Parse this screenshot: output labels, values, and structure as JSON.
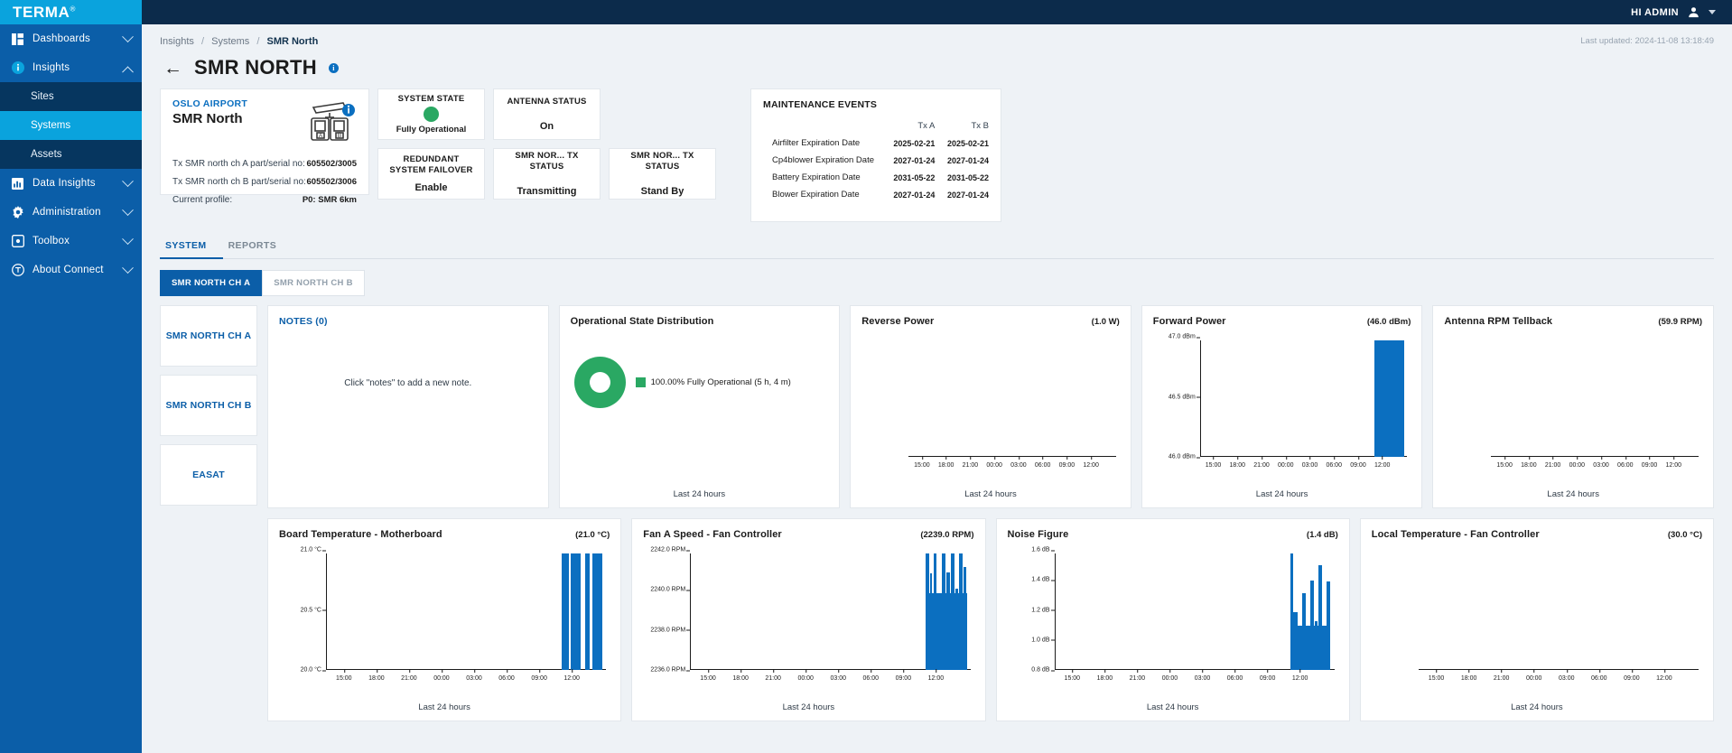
{
  "topbar": {
    "brand": "TERMA",
    "brand_sup": "®",
    "user_label": "HI ADMIN",
    "avatar_icon": "user-avatar-icon",
    "caret_icon": "chevron-down-icon"
  },
  "sidebar": {
    "items": [
      {
        "label": "Dashboards",
        "icon": "dashboard-grid-icon",
        "chevron": "chevron-down-icon",
        "expanded": false
      },
      {
        "label": "Insights",
        "icon": "info-circle-icon",
        "chevron": "chevron-up-icon",
        "expanded": true
      },
      {
        "label": "Data Insights",
        "icon": "bar-chart-icon",
        "chevron": "chevron-down-icon",
        "expanded": false
      },
      {
        "label": "Administration",
        "icon": "gear-icon",
        "chevron": "chevron-down-icon",
        "expanded": false
      },
      {
        "label": "Toolbox",
        "icon": "toolbox-icon",
        "chevron": "chevron-down-icon",
        "expanded": false
      },
      {
        "label": "About Connect",
        "icon": "t-circle-icon",
        "chevron": "chevron-down-icon",
        "expanded": false
      }
    ],
    "insights_children": [
      {
        "label": "Sites",
        "active": false
      },
      {
        "label": "Systems",
        "active": true
      },
      {
        "label": "Assets",
        "active": false
      }
    ]
  },
  "header": {
    "breadcrumb": {
      "root": "Insights",
      "middle": "Systems",
      "current": "SMR North",
      "separator": "/"
    },
    "last_updated": "Last updated: 2024-11-08 13:18:49",
    "back_icon": "back-arrow-icon",
    "title": "SMR NORTH",
    "info_icon": "info-icon",
    "info_glyph": "i"
  },
  "id_card": {
    "site": "OSLO AIRPORT",
    "system": "SMR North",
    "radar_icon": "radar-antenna-icon",
    "badge_icon": "info-icon",
    "rows": [
      {
        "label": "Tx SMR north ch A part/serial no:",
        "value": "605502/3005"
      },
      {
        "label": "Tx SMR north ch B part/serial no:",
        "value": "605502/3006"
      },
      {
        "label": "Current profile:",
        "value": "P0: SMR 6km"
      }
    ]
  },
  "tiles": [
    {
      "title": "SYSTEM STATE",
      "value": "Fully Operational",
      "indicator": "status-dot",
      "color": "#2aa863"
    },
    {
      "title": "ANTENNA STATUS",
      "value": "On",
      "indicator": "none"
    },
    {
      "title": "REDUNDANT SYSTEM FAILOVER",
      "value": "Enable",
      "indicator": "none"
    },
    {
      "title": "SMR NOR... TX STATUS",
      "value": "Transmitting",
      "indicator": "none"
    },
    {
      "title": "SMR NOR... TX STATUS",
      "value": "Stand By",
      "indicator": "none"
    }
  ],
  "maintenance": {
    "title": "MAINTENANCE EVENTS",
    "columns": [
      "",
      "Tx A",
      "Tx B"
    ],
    "rows": [
      {
        "name": "Airfilter Expiration Date",
        "tx_a": "2025-02-21",
        "tx_b": "2025-02-21"
      },
      {
        "name": "Cp4blower Expiration Date",
        "tx_a": "2027-01-24",
        "tx_b": "2027-01-24"
      },
      {
        "name": "Battery Expiration Date",
        "tx_a": "2031-05-22",
        "tx_b": "2031-05-22"
      },
      {
        "name": "Blower Expiration Date",
        "tx_a": "2027-01-24",
        "tx_b": "2027-01-24"
      }
    ]
  },
  "tabs": [
    {
      "label": "SYSTEM",
      "active": true
    },
    {
      "label": "REPORTS",
      "active": false
    }
  ],
  "channel_tabs": [
    {
      "label": "SMR NORTH CH A",
      "active": true
    },
    {
      "label": "SMR NORTH CH B",
      "active": false
    }
  ],
  "side_cards": [
    {
      "label": "SMR NORTH CH A"
    },
    {
      "label": "SMR NORTH CH B"
    },
    {
      "label": "EASAT"
    }
  ],
  "notes": {
    "title": "NOTES (0)",
    "hint": "Click \"notes\" to add a new note."
  },
  "chart_data": [
    {
      "type": "pie",
      "title": "Operational State Distribution",
      "footer": "Last 24 hours",
      "slices": [
        {
          "label": "100.00% Fully Operational (5 h, 4 m)",
          "value": 100,
          "color": "#2aa863"
        }
      ],
      "legend": "right"
    },
    {
      "type": "bar",
      "title": "Reverse Power",
      "current_value": "(1.0 W)",
      "footer": "Last 24 hours",
      "xlabel": "Last 24 hours",
      "ylabel": "",
      "yticks": [],
      "xticks": [
        "15:00",
        "18:00",
        "21:00",
        "00:00",
        "03:00",
        "06:00",
        "09:00",
        "12:00"
      ],
      "values": [],
      "grid": false
    },
    {
      "type": "bar",
      "title": "Forward Power",
      "current_value": "(46.0 dBm)",
      "footer": "Last 24 hours",
      "xlabel": "Last 24 hours",
      "yticks": [
        "47.0 dBm",
        "46.5 dBm",
        "46.0 dBm"
      ],
      "ylim": [
        46.0,
        47.0
      ],
      "xticks": [
        "15:00",
        "18:00",
        "21:00",
        "00:00",
        "03:00",
        "06:00",
        "09:00",
        "12:00"
      ],
      "bars": [
        {
          "x_pct": 84.0,
          "w_pct": 14.5,
          "h_pct": 100
        }
      ],
      "grid": false
    },
    {
      "type": "bar",
      "title": "Antenna RPM Tellback",
      "current_value": "(59.9 RPM)",
      "footer": "Last 24 hours",
      "xlabel": "Last 24 hours",
      "yticks": [],
      "xticks": [
        "15:00",
        "18:00",
        "21:00",
        "00:00",
        "03:00",
        "06:00",
        "09:00",
        "12:00"
      ],
      "values": [],
      "grid": false
    },
    {
      "type": "bar",
      "title": "Board Temperature - Motherboard",
      "current_value": "(21.0 °C)",
      "footer": "Last 24 hours",
      "xlabel": "Last 24 hours",
      "yticks": [
        "21.0 °C",
        "20.5 °C",
        "20.0 °C"
      ],
      "ylim": [
        20.0,
        21.0
      ],
      "xticks": [
        "15:00",
        "18:00",
        "21:00",
        "00:00",
        "03:00",
        "06:00",
        "09:00",
        "12:00"
      ],
      "bars": [
        {
          "x_pct": 84.0,
          "w_pct": 2.6,
          "h_pct": 100
        },
        {
          "x_pct": 87.4,
          "w_pct": 3.6,
          "h_pct": 100
        },
        {
          "x_pct": 92.4,
          "w_pct": 1.6,
          "h_pct": 100
        },
        {
          "x_pct": 95.0,
          "w_pct": 3.6,
          "h_pct": 100
        }
      ],
      "grid": false
    },
    {
      "type": "bar",
      "title": "Fan A Speed - Fan Controller",
      "current_value": "(2239.0 RPM)",
      "footer": "Last 24 hours",
      "xlabel": "Last 24 hours",
      "yticks": [
        "2242.0 RPM",
        "2240.0 RPM",
        "2238.0 RPM",
        "2236.0 RPM"
      ],
      "ylim": [
        2236.0,
        2242.0
      ],
      "xticks": [
        "15:00",
        "18:00",
        "21:00",
        "00:00",
        "03:00",
        "06:00",
        "09:00",
        "12:00"
      ],
      "bars": [
        {
          "x_pct": 84.0,
          "w_pct": 1.2,
          "h_pct": 100
        },
        {
          "x_pct": 85.6,
          "w_pct": 0.8,
          "h_pct": 83
        },
        {
          "x_pct": 86.8,
          "w_pct": 1.2,
          "h_pct": 100
        },
        {
          "x_pct": 88.4,
          "w_pct": 1.0,
          "h_pct": 62
        },
        {
          "x_pct": 89.8,
          "w_pct": 1.4,
          "h_pct": 100
        },
        {
          "x_pct": 91.6,
          "w_pct": 1.0,
          "h_pct": 84
        },
        {
          "x_pct": 93.0,
          "w_pct": 1.2,
          "h_pct": 100
        },
        {
          "x_pct": 94.6,
          "w_pct": 0.9,
          "h_pct": 70
        },
        {
          "x_pct": 95.9,
          "w_pct": 1.3,
          "h_pct": 100
        },
        {
          "x_pct": 97.6,
          "w_pct": 1.0,
          "h_pct": 88
        },
        {
          "x_pct": 84.0,
          "w_pct": 15.0,
          "h_pct": 66
        }
      ],
      "grid": false
    },
    {
      "type": "bar",
      "title": "Noise Figure",
      "current_value": "(1.4 dB)",
      "footer": "Last 24 hours",
      "xlabel": "Last 24 hours",
      "yticks": [
        "1.6 dB",
        "1.4 dB",
        "1.2 dB",
        "1.0 dB",
        "0.8 dB"
      ],
      "ylim": [
        0.8,
        1.6
      ],
      "xticks": [
        "15:00",
        "18:00",
        "21:00",
        "00:00",
        "03:00",
        "06:00",
        "09:00",
        "12:00"
      ],
      "bars": [
        {
          "x_pct": 84.2,
          "w_pct": 0.9,
          "h_pct": 100
        },
        {
          "x_pct": 85.4,
          "w_pct": 1.4,
          "h_pct": 50
        },
        {
          "x_pct": 87.2,
          "w_pct": 1.0,
          "h_pct": 14
        },
        {
          "x_pct": 88.5,
          "w_pct": 1.2,
          "h_pct": 66
        },
        {
          "x_pct": 90.1,
          "w_pct": 1.0,
          "h_pct": 26
        },
        {
          "x_pct": 91.4,
          "w_pct": 1.3,
          "h_pct": 77
        },
        {
          "x_pct": 93.0,
          "w_pct": 1.0,
          "h_pct": 42
        },
        {
          "x_pct": 94.3,
          "w_pct": 1.2,
          "h_pct": 90
        },
        {
          "x_pct": 95.8,
          "w_pct": 1.0,
          "h_pct": 18
        },
        {
          "x_pct": 97.1,
          "w_pct": 1.4,
          "h_pct": 76
        },
        {
          "x_pct": 84.2,
          "w_pct": 14.3,
          "h_pct": 38
        }
      ],
      "grid": false
    },
    {
      "type": "bar",
      "title": "Local Temperature - Fan Controller",
      "current_value": "(30.0 °C)",
      "footer": "Last 24 hours",
      "xlabel": "Last 24 hours",
      "yticks": [],
      "xticks": [
        "15:00",
        "18:00",
        "21:00",
        "00:00",
        "03:00",
        "06:00",
        "09:00",
        "12:00"
      ],
      "values": [],
      "grid": false
    }
  ],
  "colors": {
    "brand_blue": "#0aa3dd",
    "nav_blue": "#0b5ea8",
    "dark_navy": "#0c2b4b",
    "bar_blue": "#0b6fc0",
    "status_green": "#2aa863",
    "page_bg": "#eef2f6"
  }
}
